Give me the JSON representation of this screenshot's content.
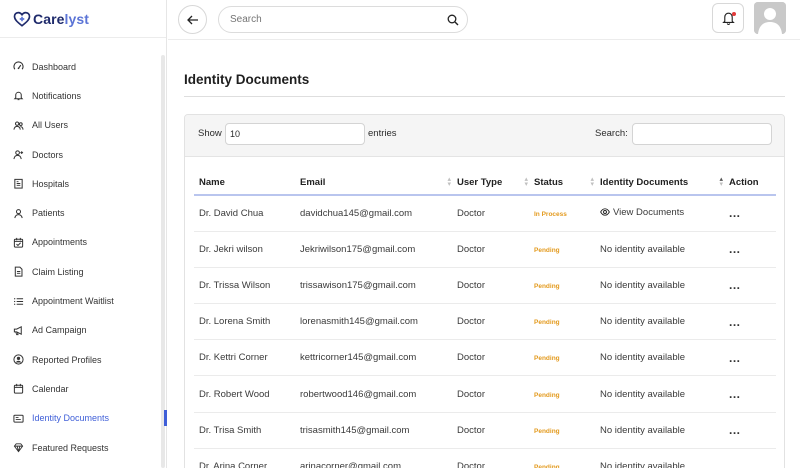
{
  "app": {
    "name_part1": "Care",
    "name_part2": "lyst"
  },
  "colors": {
    "brand_dark": "#1e2a6b",
    "brand_accent": "#5b74d6",
    "active": "#3f5fd8",
    "status_pending": "#e39a1e",
    "notification_dot": "#e23a3a"
  },
  "sidebar": {
    "items": [
      {
        "label": "Dashboard",
        "icon": "gauge-icon"
      },
      {
        "label": "Notifications",
        "icon": "bell-icon"
      },
      {
        "label": "All Users",
        "icon": "users-icon"
      },
      {
        "label": "Doctors",
        "icon": "user-plus-icon"
      },
      {
        "label": "Hospitals",
        "icon": "hospital-icon"
      },
      {
        "label": "Patients",
        "icon": "user-icon"
      },
      {
        "label": "Appointments",
        "icon": "calendar-check-icon"
      },
      {
        "label": "Claim Listing",
        "icon": "file-icon"
      },
      {
        "label": "Appointment Waitlist",
        "icon": "list-icon"
      },
      {
        "label": "Ad Campaign",
        "icon": "megaphone-icon"
      },
      {
        "label": "Reported Profiles",
        "icon": "user-circle-icon"
      },
      {
        "label": "Calendar",
        "icon": "calendar-icon"
      },
      {
        "label": "Identity Documents",
        "icon": "id-card-icon",
        "active": true
      },
      {
        "label": "Featured Requests",
        "icon": "diamond-icon"
      }
    ]
  },
  "topbar": {
    "search_placeholder": "Search"
  },
  "main": {
    "title": "Identity Documents",
    "show_label": "Show",
    "show_value": "10",
    "entries_label": "entries",
    "search_label": "Search:",
    "columns": [
      "Name",
      "Email",
      "User Type",
      "Status",
      "Identity Documents",
      "Action"
    ],
    "rows": [
      {
        "name": "Dr. David Chua",
        "email": "davidchua145@gmail.com",
        "type": "Doctor",
        "status": "In Process",
        "doc": "View Documents",
        "doc_link": true,
        "action": "..."
      },
      {
        "name": "Dr. Jekri wilson",
        "email": "Jekriwilson175@gmail.com",
        "type": "Doctor",
        "status": "Pending",
        "doc": "No identity available",
        "doc_link": false,
        "action": "..."
      },
      {
        "name": "Dr. Trissa Wilson",
        "email": "trissawison175@gmail.com",
        "type": "Doctor",
        "status": "Pending",
        "doc": "No identity available",
        "doc_link": false,
        "action": "..."
      },
      {
        "name": "Dr. Lorena Smith",
        "email": "lorenasmith145@gmail.com",
        "type": "Doctor",
        "status": "Pending",
        "doc": "No identity available",
        "doc_link": false,
        "action": "..."
      },
      {
        "name": "Dr. Kettri Corner",
        "email": "kettricorner145@gmail.com",
        "type": "Doctor",
        "status": "Pending",
        "doc": "No identity available",
        "doc_link": false,
        "action": "..."
      },
      {
        "name": "Dr. Robert Wood",
        "email": "robertwood146@gmail.com",
        "type": "Doctor",
        "status": "Pending",
        "doc": "No identity available",
        "doc_link": false,
        "action": "..."
      },
      {
        "name": "Dr. Trisa Smith",
        "email": "trisasmith145@gmail.com",
        "type": "Doctor",
        "status": "Pending",
        "doc": "No identity available",
        "doc_link": false,
        "action": "..."
      },
      {
        "name": "Dr. Arina Corner",
        "email": "arinacorner@gmail.com",
        "type": "Doctor",
        "status": "Pending",
        "doc": "No identity available",
        "doc_link": false,
        "action": "..."
      }
    ]
  }
}
